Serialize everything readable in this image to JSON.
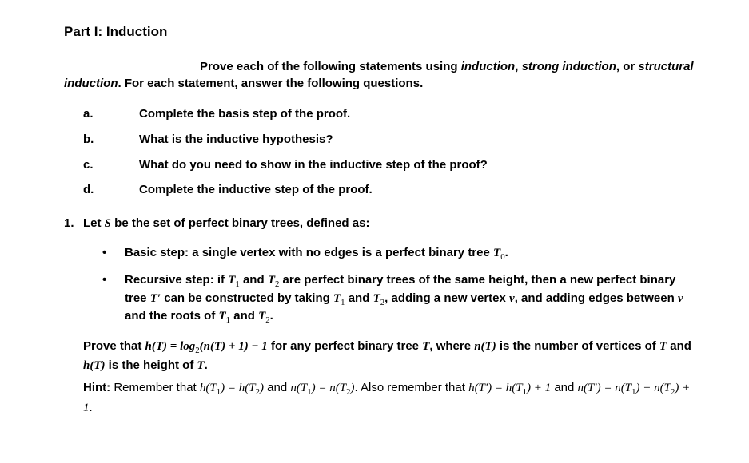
{
  "title": "Part I: Induction",
  "intro": {
    "lead": "Prove each of the following statements using ",
    "em1": "induction",
    "sep1": ", ",
    "em2": "strong induction",
    "sep2": ", or ",
    "em3": "structural induction",
    "tail": ". For each statement, answer the following questions."
  },
  "sub": {
    "a": {
      "label": "a.",
      "text": "Complete the basis step of the proof."
    },
    "b": {
      "label": "b.",
      "text": "What is the inductive hypothesis?"
    },
    "c": {
      "label": "c.",
      "text": "What do you need to show in the inductive step of the proof?"
    },
    "d": {
      "label": "d.",
      "text": "Complete the inductive step of the proof."
    }
  },
  "q1": {
    "number": "1.",
    "intro_a": "Let ",
    "intro_S": "S",
    "intro_b": " be the set of perfect binary trees, defined as:",
    "bullet1": {
      "a": "Basic step: a single vertex with no edges is a perfect binary tree ",
      "T0": "T",
      "T0sub": "0",
      "b": "."
    },
    "bullet2": {
      "a": "Recursive step: if ",
      "T1": "T",
      "T1sub": "1",
      "b": " and ",
      "T2": "T",
      "T2sub": "2",
      "c": " are perfect binary trees of the same height, then a new perfect binary tree ",
      "Tp": "T′",
      "d": " can be constructed by taking ",
      "T1b": "T",
      "T1bsub": "1",
      "e": " and ",
      "T2b": "T",
      "T2bsub": "2",
      "f": ", adding a new vertex ",
      "v": "v",
      "g": ", and adding edges between ",
      "v2": "v",
      "h": " and the roots of ",
      "T1c": "T",
      "T1csub": "1",
      "i": " and ",
      "T2c": "T",
      "T2csub": "2",
      "j": "."
    },
    "prove": {
      "a": "Prove that ",
      "eq": "h(T) = log",
      "eq_sub": "2",
      "eq2": "(n(T) + 1) − 1",
      "b": " for any perfect binary tree ",
      "T": "T",
      "c": ", where ",
      "nT": "n(T)",
      "d": " is the number of vertices of ",
      "T2": "T",
      "e": " and ",
      "hT": "h(T)",
      "f": " is the height of ",
      "T3": "T",
      "g": "."
    },
    "hint": {
      "label": "Hint:",
      "a": " Remember that ",
      "e1": "h(T",
      "e1sub": "1",
      "e1b": ") = h(T",
      "e1sub2": "2",
      "e1c": ")",
      "b": " and ",
      "e2": "n(T",
      "e2sub": "1",
      "e2b": ") = n(T",
      "e2sub2": "2",
      "e2c": ")",
      "c": ". Also remember that ",
      "e3": "h(T′) = h(T",
      "e3sub": "1",
      "e3b": ") + 1",
      "d": " and ",
      "e4": "n(T′) = n(T",
      "e4sub": "1",
      "e4b": ") + n(T",
      "e4sub2": "2",
      "e4c": ") + 1",
      "e": "."
    }
  }
}
